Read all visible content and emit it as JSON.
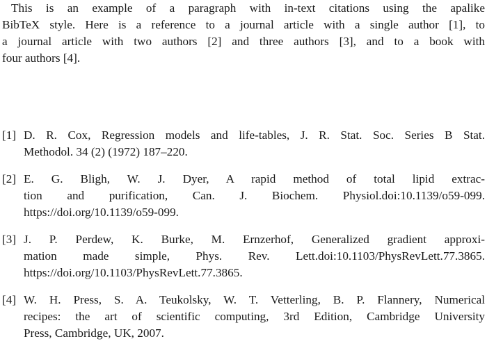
{
  "document": {
    "background_color": "#ffffff",
    "text_color": "#1a1a1a"
  },
  "intro_paragraph": {
    "full_text": "This is an example of a paragraph with in-text citations using the apalike BibTeX style. Here is a reference to a journal article with a single author [1], to a journal article with two authors [2] and three authors [3], and to a book with four authors [4].",
    "lines": [
      "This is an example of a paragraph with in-text citations using the apalike",
      "BibTeX style. Here is a reference to a journal article with a single author [1], to",
      "a journal article with two authors [2] and three authors [3], and to a book with",
      "four authors [4]."
    ]
  },
  "bibliography": {
    "entries": [
      {
        "label": "[1]",
        "full_text": "D. R. Cox, Regression models and life-tables, J. R. Stat. Soc. Series B Stat. Methodol. 34 (2) (1972) 187–220.",
        "lines": [
          "D. R. Cox, Regression models and life-tables, J. R. Stat. Soc. Series B Stat.",
          "Methodol. 34 (2) (1972) 187–220."
        ]
      },
      {
        "label": "[2]",
        "full_text": "E. G. Bligh, W. J. Dyer, A rapid method of total lipid extraction and purification, Can. J. Biochem. Physiol.doi:10.1139/o59-099. https://doi.org/10.1139/o59-099.",
        "lines": [
          "E. G. Bligh, W. J. Dyer, A rapid method of total lipid extrac-",
          "tion and purification, Can. J. Biochem. Physiol.doi:10.1139/o59-099.",
          "https://doi.org/10.1139/o59-099."
        ]
      },
      {
        "label": "[3]",
        "full_text": "J. P. Perdew, K. Burke, M. Ernzerhof, Generalized gradient approximation made simple, Phys. Rev. Lett.doi:10.1103/PhysRevLett.77.3865. https://doi.org/10.1103/PhysRevLett.77.3865.",
        "lines": [
          "J. P. Perdew, K. Burke, M. Ernzerhof, Generalized gradient approxi-",
          "mation made simple, Phys. Rev. Lett.doi:10.1103/PhysRevLett.77.3865.",
          "https://doi.org/10.1103/PhysRevLett.77.3865."
        ]
      },
      {
        "label": "[4]",
        "full_text": "W. H. Press, S. A. Teukolsky, W. T. Vetterling, B. P. Flannery, Numerical recipes: the art of scientific computing, 3rd Edition, Cambridge University Press, Cambridge, UK, 2007.",
        "lines": [
          "W. H. Press, S. A. Teukolsky, W. T. Vetterling, B. P. Flannery, Numerical",
          "recipes: the art of scientific computing, 3rd Edition, Cambridge University",
          "Press, Cambridge, UK, 2007."
        ]
      }
    ]
  }
}
